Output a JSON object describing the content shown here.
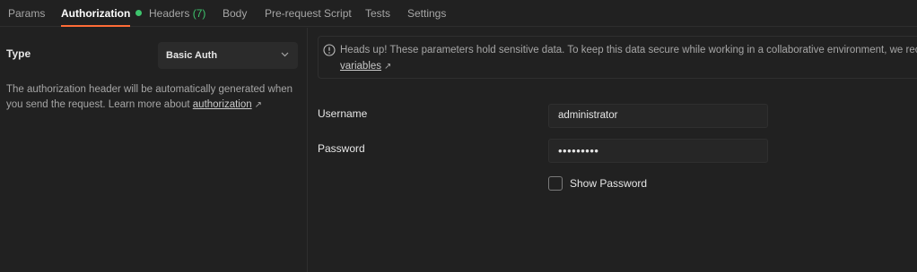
{
  "tabs": [
    {
      "label": "Params"
    },
    {
      "label": "Authorization"
    },
    {
      "label": "Headers",
      "count": "(7)"
    },
    {
      "label": "Body"
    },
    {
      "label": "Pre-request Script"
    },
    {
      "label": "Tests"
    },
    {
      "label": "Settings"
    }
  ],
  "active_tab": "Authorization",
  "colors": {
    "accent": "#ff6c37",
    "status_dot": "#3ec46d",
    "background": "#212121"
  },
  "auth": {
    "type_label": "Type",
    "type_value": "Basic Auth",
    "description": "The authorization header will be automatically generated when you send the request. Learn more about ",
    "description_link": "authorization",
    "description_link_arrow": "↗"
  },
  "notice": {
    "line1": "Heads up! These parameters hold sensitive data. To keep this data secure while working in a collaborative environment, we recomm",
    "link": "variables",
    "link_arrow": "↗"
  },
  "fields": {
    "username_label": "Username",
    "username_value": "administrator",
    "password_label": "Password",
    "password_value": "•••••••••",
    "show_password_label": "Show Password",
    "show_password_checked": false
  },
  "icons": {
    "select_chevron": "chevron-down-icon",
    "notice_icon": "info-icon"
  }
}
